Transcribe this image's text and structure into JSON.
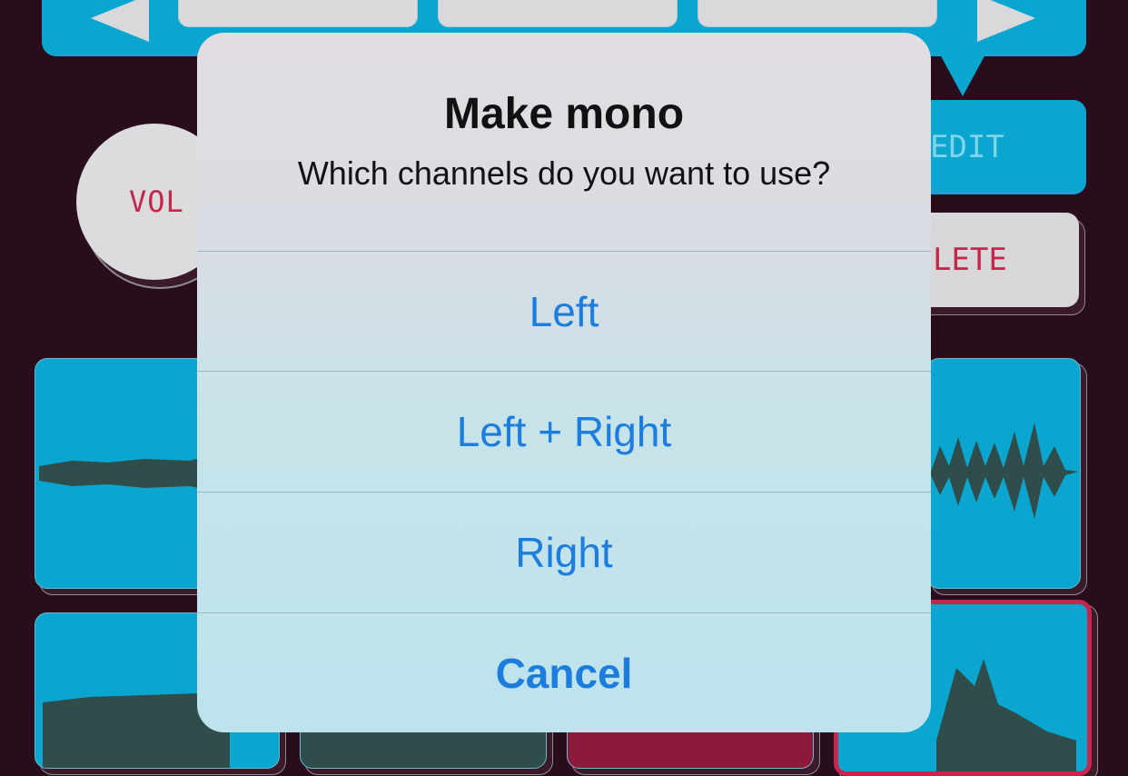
{
  "colors": {
    "background": "#2a0d1c",
    "pad_blue": "#0aa6cf",
    "pad_selected_border": "#c8254d",
    "accent": "#1d7ddd"
  },
  "controls": {
    "vol_label": "VOL",
    "edit_label": "EDIT",
    "delete_label": "DELETE"
  },
  "alert": {
    "title": "Make mono",
    "message": "Which channels do you want to use?",
    "actions": [
      {
        "label": "Left",
        "style": "default"
      },
      {
        "label": "Left + Right",
        "style": "default"
      },
      {
        "label": "Right",
        "style": "default"
      },
      {
        "label": "Cancel",
        "style": "cancel"
      }
    ]
  },
  "icons": {
    "previous": "triangle-left-icon",
    "next": "triangle-right-icon",
    "waveform": "waveform-icon"
  }
}
